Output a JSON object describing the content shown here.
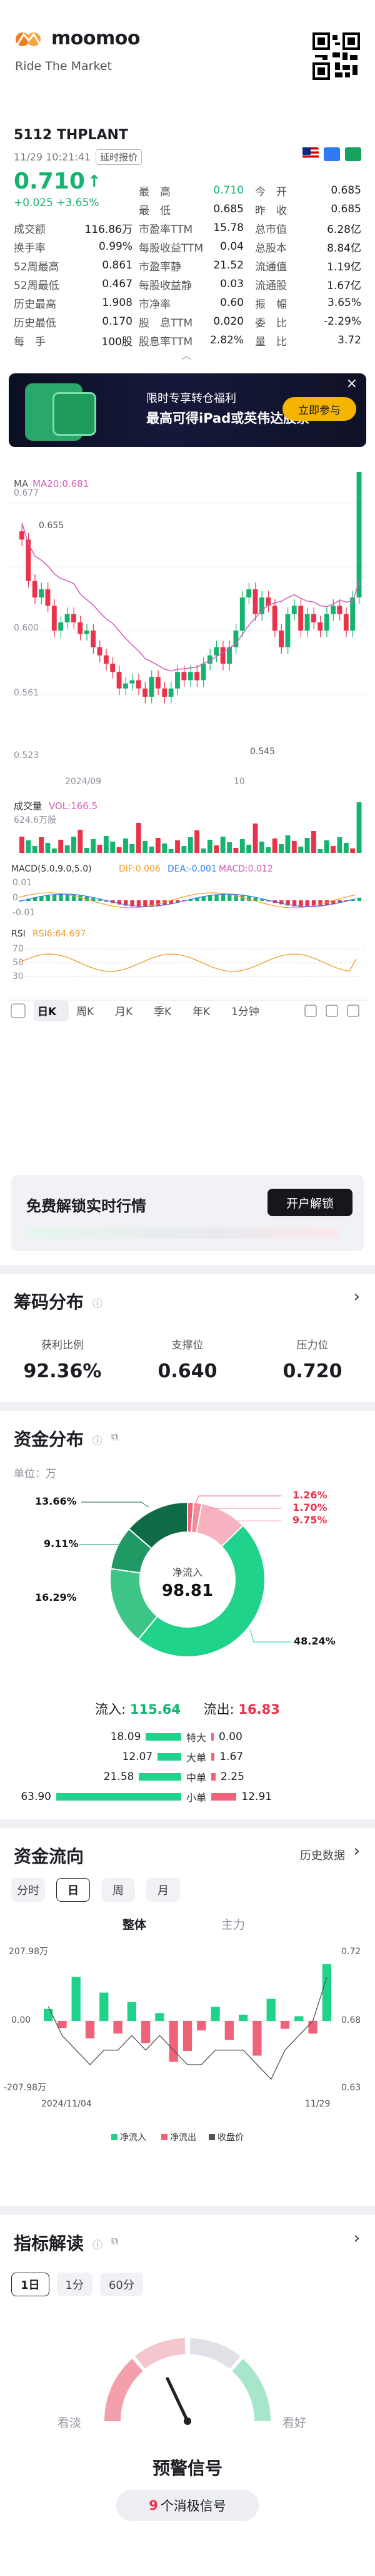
{
  "header": {
    "brand": "moomoo",
    "slogan": "Ride The Market"
  },
  "quote": {
    "code": "5112",
    "name": "THPLANT",
    "datetime": "11/29 10:21:41",
    "delay_tag": "延时报价",
    "price": "0.710",
    "change": "+0.025 +3.65%",
    "col1": [
      {
        "label": "成交额",
        "value": "116.86万"
      },
      {
        "label": "换手率",
        "value": "0.99%"
      },
      {
        "label": "52周最高",
        "value": "0.861"
      },
      {
        "label": "52周最低",
        "value": "0.467"
      },
      {
        "label": "历史最高",
        "value": "1.908"
      },
      {
        "label": "历史最低",
        "value": "0.170"
      },
      {
        "label": "每　手",
        "value": "100股"
      }
    ],
    "col2": [
      {
        "label": "最　高",
        "value": "0.710",
        "color": "#14b470"
      },
      {
        "label": "最　低",
        "value": "0.685",
        "color": "#1b1d22"
      },
      {
        "label": "市盈率TTM",
        "value": "15.78",
        "color": "#1b1d22"
      },
      {
        "label": "每股收益TTM",
        "value": "0.04",
        "color": "#1b1d22"
      },
      {
        "label": "市盈率静",
        "value": "21.52",
        "color": "#1b1d22"
      },
      {
        "label": "每股收益静",
        "value": "0.03",
        "color": "#1b1d22"
      },
      {
        "label": "市净率",
        "value": "0.60",
        "color": "#1b1d22"
      },
      {
        "label": "股　息TTM",
        "value": "0.020",
        "color": "#1b1d22"
      },
      {
        "label": "股息率TTM",
        "value": "2.82%",
        "color": "#1b1d22"
      }
    ],
    "col3": [
      {
        "label": "今　开",
        "value": "0.685"
      },
      {
        "label": "昨　收",
        "value": "0.685"
      },
      {
        "label": "总市值",
        "value": "6.28亿"
      },
      {
        "label": "总股本",
        "value": "8.84亿"
      },
      {
        "label": "流通值",
        "value": "1.19亿"
      },
      {
        "label": "流通股",
        "value": "1.67亿"
      },
      {
        "label": "振　幅",
        "value": "3.65%"
      },
      {
        "label": "委　比",
        "value": "-2.29%"
      },
      {
        "label": "量　比",
        "value": "3.72"
      }
    ]
  },
  "banner": {
    "line1": "限时专享转仓福利",
    "line2": "最高可得iPad或英伟达股票",
    "button": "立即参与",
    "close": "×"
  },
  "kline": {
    "ma_label": "MA",
    "ma_value": "MA20:0.681",
    "y_ticks": [
      "0.677",
      "0.600",
      "0.561",
      "0.523"
    ],
    "high_label": "0.655",
    "low_label": "0.545",
    "x_ticks": [
      "2024/09",
      "10"
    ],
    "vol_title": "成交量",
    "vol_value": "VOL:166.5",
    "vol_max": "624.6万股",
    "macd_title": "MACD(5.0,9.0,5.0)",
    "macd_dif": "DIF:0.006",
    "macd_dea": "DEA:-0.001",
    "macd_val": "MACD:0.012",
    "macd_ticks": [
      "0.01",
      "0",
      "-0.01"
    ],
    "rsi_title": "RSI",
    "rsi_value": "RSI6:64.697",
    "rsi_ticks": [
      "70",
      "50",
      "30"
    ],
    "period_tabs": [
      "日K",
      "周K",
      "月K",
      "季K",
      "年K",
      "1分钟"
    ],
    "active_period": "日K"
  },
  "level2": {
    "title": "免费解锁实时行情",
    "button": "开户解锁"
  },
  "chip": {
    "title": "筹码分布",
    "items": [
      {
        "label": "获利比例",
        "value": "92.36%"
      },
      {
        "label": "支撑位",
        "value": "0.640"
      },
      {
        "label": "压力位",
        "value": "0.720"
      }
    ]
  },
  "capital": {
    "title": "资金分布",
    "unit": "单位：万",
    "center_label": "净流入",
    "center_value": "98.81",
    "pct_labels": [
      "1.26%",
      "1.70%",
      "9.75%",
      "13.66%",
      "9.11%",
      "16.29%",
      "48.24%"
    ],
    "inflow_label": "流入:",
    "inflow": "115.64",
    "outflow_label": "流出:",
    "outflow": "16.83",
    "rows": [
      {
        "in": "18.09",
        "label": "特大",
        "out": "0.00"
      },
      {
        "in": "12.07",
        "label": "大单",
        "out": "1.67"
      },
      {
        "in": "21.58",
        "label": "中单",
        "out": "2.25"
      },
      {
        "in": "63.90",
        "label": "小单",
        "out": "12.91"
      }
    ]
  },
  "flow": {
    "title": "资金流向",
    "history": "历史数据",
    "tabs": [
      "分时",
      "日",
      "周",
      "月"
    ],
    "active_tab": "日",
    "subtabs": [
      "整体",
      "主力"
    ],
    "y_left": [
      "207.98万",
      "0.00",
      "-207.98万"
    ],
    "y_right": [
      "0.72",
      "0.68",
      "0.63"
    ],
    "x_ticks": [
      "2024/11/04",
      "11/29"
    ],
    "legend": [
      "净流入",
      "净流出",
      "收盘价"
    ]
  },
  "indicator": {
    "title": "指标解读",
    "tabs": [
      "1日",
      "1分",
      "60分"
    ],
    "active_tab": "1日",
    "left": "看淡",
    "right": "看好",
    "signal": "预警信号",
    "count": "9",
    "count_text": "个消极信号"
  },
  "chart_data": [
    {
      "type": "candlestick",
      "title": "",
      "series": [
        {
          "name": "MA20",
          "value_last": 0.681
        }
      ],
      "ylim": [
        0.523,
        0.677
      ],
      "annotations": {
        "high": 0.655,
        "low": 0.545
      },
      "x_labels": [
        "2024/09",
        "10"
      ]
    },
    {
      "type": "bar",
      "title": "VOL",
      "flow_values_wan": [
        38,
        -22,
        140,
        -55,
        90,
        -40,
        60,
        -70,
        25,
        -130,
        -95,
        -30,
        45,
        -60,
        20,
        -110,
        70,
        -25,
        15,
        -40,
        180
      ],
      "close_prices": [
        0.69,
        0.67,
        0.66,
        0.65,
        0.66,
        0.66,
        0.67,
        0.66,
        0.67,
        0.66,
        0.65,
        0.65,
        0.66,
        0.66,
        0.66,
        0.65,
        0.64,
        0.66,
        0.67,
        0.68,
        0.71
      ]
    }
  ]
}
